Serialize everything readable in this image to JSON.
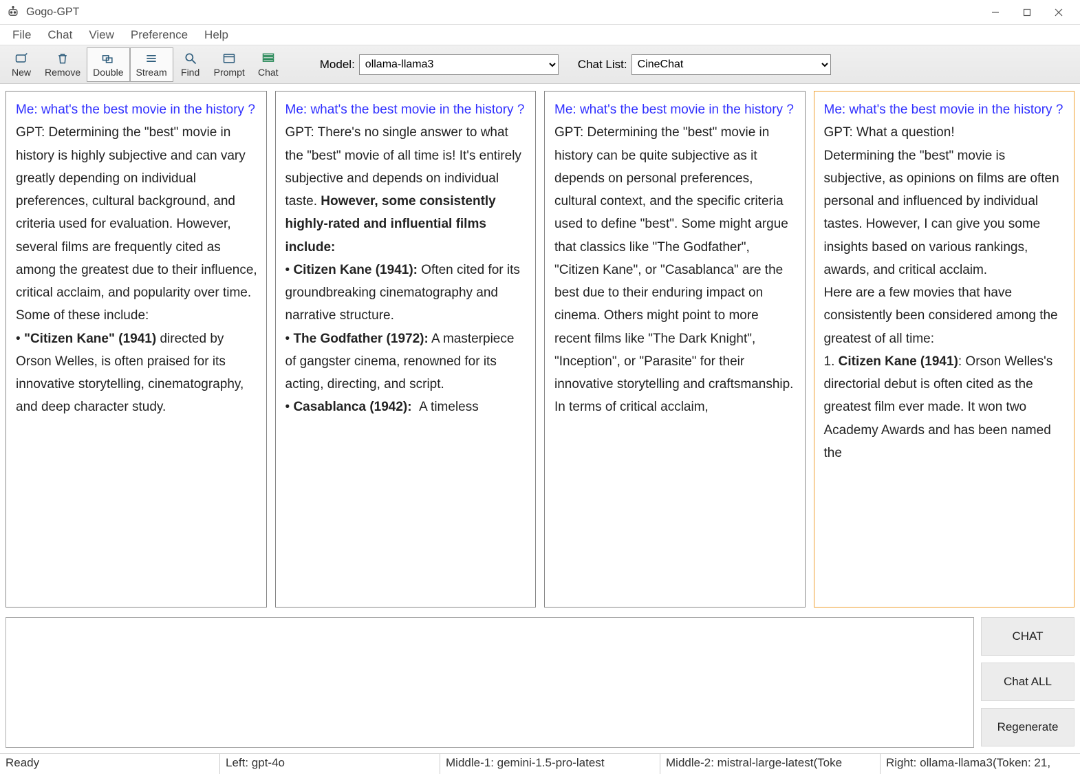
{
  "window": {
    "title": "Gogo-GPT"
  },
  "menu": {
    "items": [
      "File",
      "Chat",
      "View",
      "Preference",
      "Help"
    ]
  },
  "toolbar": {
    "buttons": [
      {
        "id": "new",
        "label": "New"
      },
      {
        "id": "remove",
        "label": "Remove"
      },
      {
        "id": "double",
        "label": "Double"
      },
      {
        "id": "stream",
        "label": "Stream"
      },
      {
        "id": "find",
        "label": "Find"
      },
      {
        "id": "prompt",
        "label": "Prompt"
      },
      {
        "id": "chat",
        "label": "Chat"
      }
    ],
    "model_label": "Model:",
    "model_value": "ollama-llama3",
    "chatlist_label": "Chat List:",
    "chatlist_value": "CineChat"
  },
  "panes": [
    {
      "me": "Me: what's the best movie in the history ?",
      "gpt_html": "GPT: Determining the \"best\" movie in history is highly subjective and can vary greatly depending on individual preferences, cultural background, and criteria used for evaluation. However, several films are frequently cited as among the greatest due to their influence, critical acclaim, and popularity over time. Some of these include:<br>• <strong>\"Citizen Kane\" (1941)</strong> directed by Orson Welles, is often praised for its innovative storytelling, cinematography, and deep character study."
    },
    {
      "me": "Me: what's the best movie in the history ?",
      "gpt_html": "GPT: There's no single answer to what the \"best\" movie of all time is! It's entirely subjective and depends on individual taste. <strong>However, some consistently highly-rated and influential films include:</strong><br>• <strong>Citizen Kane (1941):</strong> Often cited for its groundbreaking cinematography and narrative structure.<br>• <strong>The Godfather (1972):</strong> A masterpiece of gangster cinema, renowned for its acting, directing, and script.<br>• <strong>Casablanca (1942):</strong> &nbsp;A timeless"
    },
    {
      "me": "Me: what's the best movie in the history ?",
      "gpt_html": "GPT: Determining the \"best\" movie in history can be quite subjective as it depends on personal preferences, cultural context, and the specific criteria used to define \"best\". Some might argue that classics like \"The Godfather\", \"Citizen Kane\", or \"Casablanca\" are the best due to their enduring impact on cinema. Others might point to more recent films like \"The Dark Knight\", \"Inception\", or \"Parasite\" for their innovative storytelling and craftsmanship.<br>In terms of critical acclaim,"
    },
    {
      "me": "Me: what's the best movie in the history ?",
      "gpt_html": "GPT: What a question!<br>Determining the \"best\" movie is subjective, as opinions on films are often personal and influenced by individual tastes. However, I can give you some insights based on various rankings, awards, and critical acclaim.<br>Here are a few movies that have consistently been considered among the greatest of all time:<br>1. <strong>Citizen Kane (1941)</strong>: Orson Welles's directorial debut is often cited as the greatest film ever made. It won two Academy Awards and has been named the"
    }
  ],
  "buttons": {
    "chat": "CHAT",
    "chat_all": "Chat ALL",
    "regenerate": "Regenerate"
  },
  "status": {
    "ready": "Ready",
    "left": "Left: gpt-4o",
    "mid1": "Middle-1: gemini-1.5-pro-latest",
    "mid2": "Middle-2: mistral-large-latest(Toke",
    "right": "Right: ollama-llama3(Token: 21,"
  }
}
